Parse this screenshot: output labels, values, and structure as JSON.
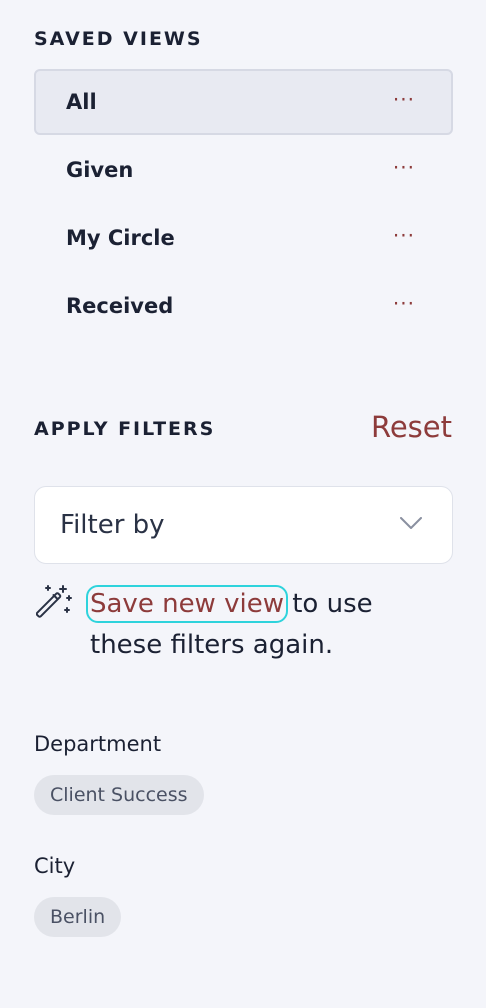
{
  "saved_views": {
    "heading": "SAVED VIEWS",
    "items": [
      {
        "label": "All",
        "more": "···"
      },
      {
        "label": "Given",
        "more": "···"
      },
      {
        "label": "My Circle",
        "more": "···"
      },
      {
        "label": "Received",
        "more": "···"
      }
    ],
    "active_index": 0
  },
  "filters": {
    "heading": "APPLY FILTERS",
    "reset_label": "Reset",
    "select_label": "Filter by",
    "save_link": "Save new view",
    "save_hint_rest": " to use these filters again."
  },
  "applied": {
    "department_label": "Department",
    "department_value": "Client Success",
    "city_label": "City",
    "city_value": "Berlin"
  },
  "colors": {
    "accent": "#8d3b3b",
    "focus": "#2ed3dc",
    "background": "#f4f5fa"
  },
  "icons": {
    "more": "ellipsis-icon",
    "select": "chevron-down-icon",
    "save": "magic-wand-icon"
  }
}
